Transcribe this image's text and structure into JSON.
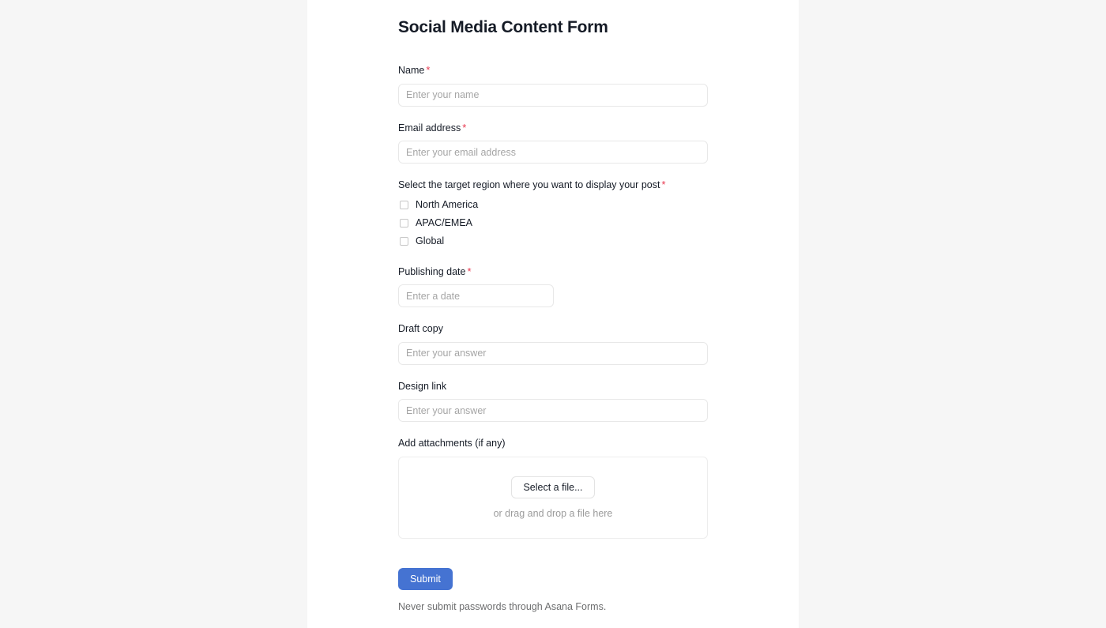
{
  "colors": {
    "page_background": "#f6f6f6",
    "card_background": "#ffffff",
    "text": "#151b26",
    "placeholder": "#a5a5a5",
    "required_asterisk": "#e8384f",
    "submit_button": "#4573d2",
    "muted_text": "#6d6e6f",
    "input_border": "#e8e8e8"
  },
  "form": {
    "title": "Social Media Content Form",
    "required_marker": "*",
    "fields": {
      "name": {
        "label": "Name",
        "required": true,
        "placeholder": "Enter your name",
        "value": ""
      },
      "email": {
        "label": "Email address",
        "required": true,
        "placeholder": "Enter your email address",
        "value": ""
      },
      "target_region": {
        "label": "Select the target region where you want to display your post",
        "required": true,
        "options": [
          {
            "label": "North America",
            "checked": false
          },
          {
            "label": "APAC/EMEA",
            "checked": false
          },
          {
            "label": "Global",
            "checked": false
          }
        ]
      },
      "publishing_date": {
        "label": "Publishing date",
        "required": true,
        "placeholder": "Enter a date",
        "value": ""
      },
      "draft_copy": {
        "label": "Draft copy",
        "required": false,
        "placeholder": "Enter your answer",
        "value": ""
      },
      "design_link": {
        "label": "Design link",
        "required": false,
        "placeholder": "Enter your answer",
        "value": ""
      },
      "attachments": {
        "label": "Add attachments (if any)",
        "required": false,
        "select_file_label": "Select a file...",
        "drag_hint": "or drag and drop a file here"
      }
    },
    "submit_label": "Submit",
    "footer_note": "Never submit passwords through Asana Forms."
  }
}
